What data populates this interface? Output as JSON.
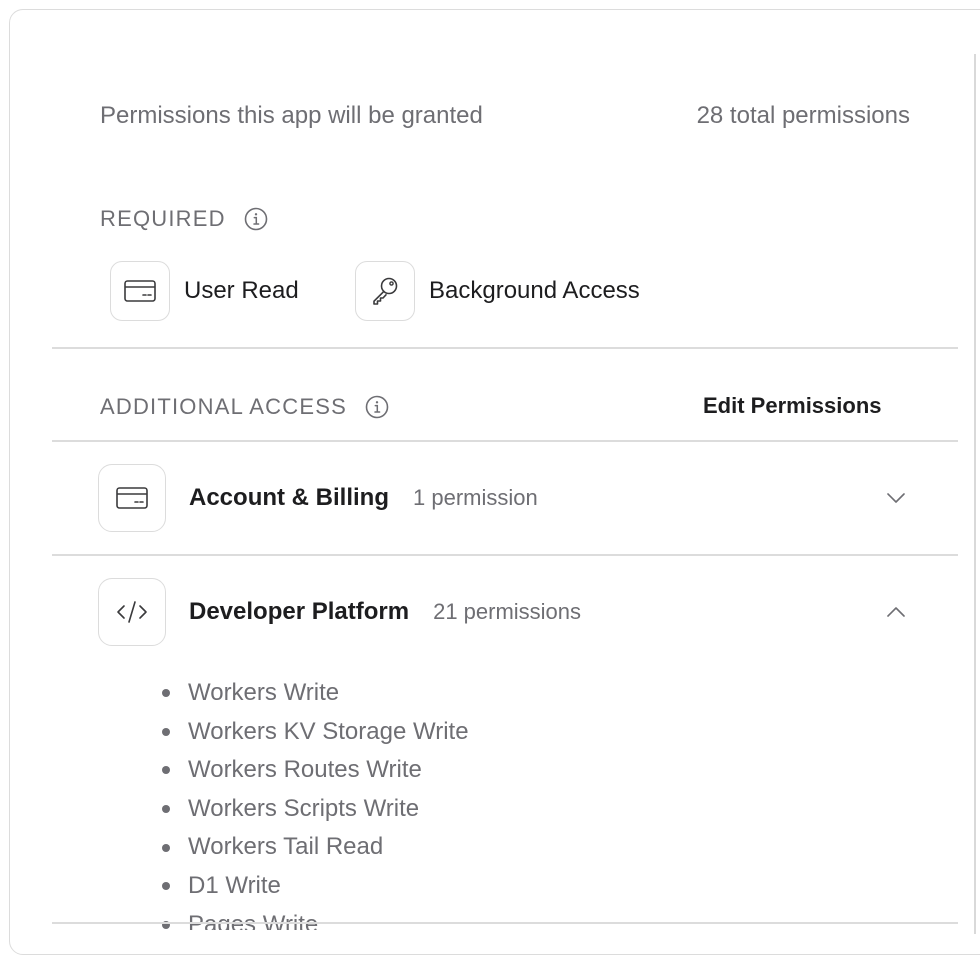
{
  "header": {
    "title": "Permissions this app will be granted",
    "total": "28 total permissions"
  },
  "required": {
    "label": "REQUIRED",
    "items": [
      {
        "label": "User Read",
        "icon": "card-icon"
      },
      {
        "label": "Background Access",
        "icon": "key-icon"
      }
    ]
  },
  "additional": {
    "label": "ADDITIONAL ACCESS",
    "edit_label": "Edit Permissions",
    "groups": [
      {
        "title": "Account & Billing",
        "count": "1 permission",
        "icon": "card-icon",
        "expanded": false
      },
      {
        "title": "Developer Platform",
        "count": "21 permissions",
        "icon": "code-icon",
        "expanded": true,
        "items": [
          "Workers Write",
          "Workers KV Storage Write",
          "Workers Routes Write",
          "Workers Scripts Write",
          "Workers Tail Read",
          "D1 Write",
          "Pages Write"
        ]
      }
    ]
  }
}
